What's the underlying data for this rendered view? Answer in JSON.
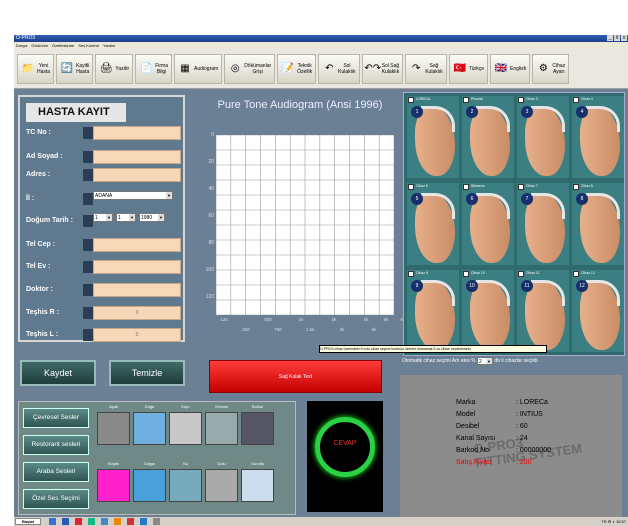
{
  "window": {
    "title": "O-PRO3",
    "buttons": [
      "_",
      "ð",
      "x"
    ]
  },
  "menu": [
    "Dosya",
    "Görünüm",
    "Özellestirme",
    "Ses Kontrol",
    "Yardim"
  ],
  "toolbar": [
    {
      "label": "Yeni\nHasta",
      "icon": "folder-icon",
      "glyph": "📁"
    },
    {
      "label": "Kayitli\nHasta",
      "icon": "refresh-icon",
      "glyph": "🔄"
    },
    {
      "label": "Yazdir",
      "icon": "printer-icon",
      "glyph": "🖨"
    },
    {
      "label": "Firma\nBilgi",
      "icon": "info-icon",
      "glyph": "📄"
    },
    {
      "label": "Audiogram",
      "icon": "grid-icon",
      "glyph": "▦"
    },
    {
      "label": "Dökümanlar\nGrişi",
      "icon": "cd-icon",
      "glyph": "◎"
    },
    {
      "label": "Teknik\nÖzellik",
      "icon": "document-icon",
      "glyph": "📝"
    },
    {
      "label": "Sol\nKulaklık",
      "icon": "left-hearing-aid-icon",
      "glyph": "↶"
    },
    {
      "label": "Sol Sağ\nKulaklık",
      "icon": "both-hearing-aids-icon",
      "glyph": "↶↷"
    },
    {
      "label": "Sağ\nKulaklık",
      "icon": "right-hearing-aid-icon",
      "glyph": "↷"
    },
    {
      "label": "Türkçe",
      "icon": "turkish-flag-icon",
      "glyph": "🇹🇷"
    },
    {
      "label": "English",
      "icon": "uk-flag-icon",
      "glyph": "🇬🇧"
    },
    {
      "label": "Cihaz\nAyarı",
      "icon": "gear-icon",
      "glyph": "⚙"
    }
  ],
  "form": {
    "title": "HASTA KAYIT",
    "labels": [
      "TC No :",
      "Ad Soyad :",
      "Adres :",
      "İl :",
      "Doğum Tarih :",
      "Tel Cep :",
      "Tel Ev :",
      "Doktor :",
      "Teşhis R :",
      "Teşhis L :"
    ],
    "il_value": "ADANA",
    "dogum": {
      "day": "1",
      "month": "1",
      "year": "1980"
    },
    "teshis_r": "0",
    "teshis_l": "0",
    "kaydet": "Kaydet",
    "temizle": "Temizle"
  },
  "audiogram": {
    "title": "Pure Tone Audiogram (Ansi 1996)",
    "y_ticks": [
      "0",
      "20",
      "40",
      "60",
      "80",
      "100",
      "120"
    ],
    "x_top": [
      "125",
      "500",
      "2k",
      "8k"
    ],
    "x_top_extra": [
      "1k",
      "4k"
    ],
    "x_bottom": [
      "250",
      "750",
      "1.5k",
      "3k",
      "6k"
    ],
    "right_label": "K",
    "button": "Sağ Kulak Test"
  },
  "tooltip": "O-PRO3 cihaz üzerindeki 9 nolu cihaz seçme kontrolu üzerine tıklanarak 9 cu cihazı seçebilirsiniz",
  "devices": {
    "names": [
      "LORECa",
      "Phonak",
      "Cihaz 3",
      "Cihaz 4",
      "Cihaz 5",
      "Siemens",
      "Cihaz 7",
      "Cihaz 8",
      "Cihaz 9",
      "Cihaz 10",
      "Cihaz 11",
      "Cihaz 12"
    ],
    "numbers": [
      "1",
      "2",
      "3",
      "4",
      "5",
      "6",
      "7",
      "8",
      "9",
      "10",
      "11",
      "12"
    ]
  },
  "otomatik": {
    "label": "Otomatik cihaz seçimi  Artı eksi %",
    "value": "2",
    "suffix": "db li cihazlar seçildi."
  },
  "info": {
    "rows": [
      {
        "k": "Marka",
        "v": ": LORECa"
      },
      {
        "k": "Model",
        "v": ": INTIUS"
      },
      {
        "k": "Desibel",
        "v": ": 60"
      },
      {
        "k": "Kanal Sayısı",
        "v": ": 24"
      },
      {
        "k": "Barkod No",
        "v": ": 00000000"
      },
      {
        "k": "Satış Fiyatı",
        "v": ": 200"
      }
    ],
    "watermark": "O-PRO3\nFITTING SYSTEM"
  },
  "sounds": {
    "buttons": [
      "Çevresel Sesler",
      "Restorant sesleri",
      "Araba Sesleri",
      "Özel Ses Seçimi"
    ],
    "row1": [
      "Ayak",
      "Doğa",
      "Kapı",
      "Yıldırım",
      "Bulbul"
    ],
    "row2": [
      "Köpek",
      "Dalga",
      "Su",
      "Dolu",
      "Gurultu"
    ]
  },
  "cevap": "CEVAP",
  "taskbar": {
    "start": "Başlat",
    "tray": "TR  ⚙  ◐  16:57"
  },
  "colors": {
    "window_bg": "#6b7f95",
    "input_bg": "#f6d7b8",
    "device_panel": "#2e6a6e",
    "red_button": "#e01010",
    "green_ring": "#2bd145"
  }
}
